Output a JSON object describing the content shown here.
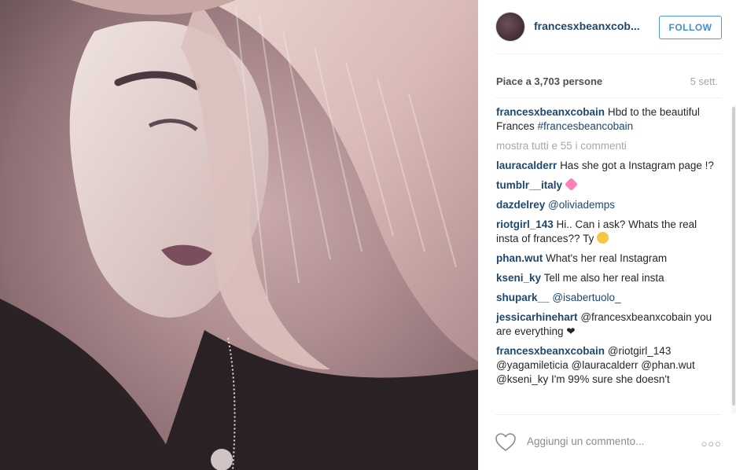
{
  "post": {
    "username": "francesxbeanxcobain",
    "username_truncated": "francesxbeanxcob...",
    "follow_label": "FOLLOW",
    "likes": "Piace a 3,703 persone",
    "time": "5 sett.",
    "caption": {
      "username": "francesxbeanxcobain",
      "text": "Hbd to the beautiful Frances",
      "hashtag": "#francesbeancobain"
    },
    "show_all": "mostra tutti e 55 i commenti",
    "comments": [
      {
        "user": "lauracalderr",
        "text": "Has she got a Instagram page !?"
      },
      {
        "user": "tumblr__italy",
        "text": "",
        "emoji": "sparkling-heart"
      },
      {
        "user": "dazdelrey",
        "text": "@oliviademps"
      },
      {
        "user": "riotgirl_143",
        "text": "Hi.. Can i ask? Whats the real insta of frances?? Ty",
        "emoji": "kiss-face"
      },
      {
        "user": "phan.wut",
        "text": "What's her real Instagram"
      },
      {
        "user": "kseni_ky",
        "text": "Tell me also her real insta"
      },
      {
        "user": "shupark__",
        "text": "@isabertuolo_"
      },
      {
        "user": "jessicarhinehart",
        "text": "@francesxbeanxcobain you are everything ❤"
      },
      {
        "user": "francesxbeanxcobain",
        "text": "@riotgirl_143 @yagamileticia @lauracalderr @phan.wut @kseni_ky I'm 99% sure she doesn't"
      }
    ],
    "add_comment_placeholder": "Aggiungi un commento...",
    "options_label": "○○○"
  },
  "colors": {
    "link": "#1e4770",
    "follow_blue": "#3f8fd6",
    "muted": "#a5a7aa"
  }
}
